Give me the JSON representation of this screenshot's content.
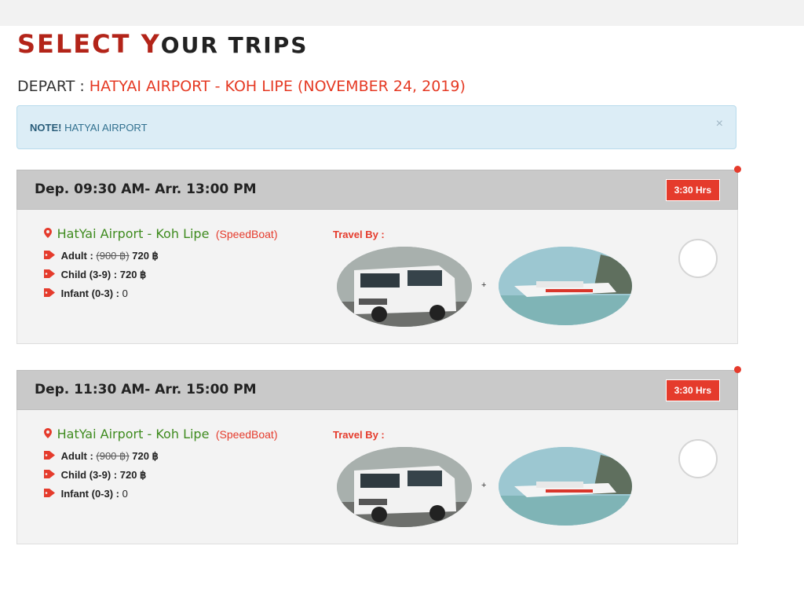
{
  "header": {
    "title_s": "S",
    "title_elect": "ELECT ",
    "title_y": "Y",
    "title_rest": "OUR TRIPS"
  },
  "depart": {
    "label": "DEPART : ",
    "route": "HATYAI AIRPORT - KOH LIPE (NOVEMBER 24, 2019)"
  },
  "note": {
    "bold": "NOTE!",
    "text": " HATYAI AIRPORT",
    "close": "×"
  },
  "trips": [
    {
      "time": "Dep.  09:30 AM- Arr. 13:00 PM",
      "duration": "3:30 Hrs",
      "route": "HatYai Airport - Koh Lipe",
      "vehicle": "(SpeedBoat)",
      "adult_label": "Adult : ",
      "adult_old": "(900 ฿)",
      "adult_price": " 720 ฿",
      "child": "Child (3-9) : 720 ฿",
      "infant_label": "Infant (0-3) : ",
      "infant_price": "0",
      "travel_by": "Travel By :",
      "plus": "+"
    },
    {
      "time": "Dep.  11:30 AM- Arr. 15:00 PM",
      "duration": "3:30 Hrs",
      "route": "HatYai Airport - Koh Lipe",
      "vehicle": "(SpeedBoat)",
      "adult_label": "Adult : ",
      "adult_old": "(900 ฿)",
      "adult_price": " 720 ฿",
      "child": "Child (3-9) : 720 ฿",
      "infant_label": "Infant (0-3) : ",
      "infant_price": "0",
      "travel_by": "Travel By :",
      "plus": "+"
    }
  ],
  "icons": {
    "pin": "map-marker-icon",
    "tag": "tag-icon",
    "close": "close-icon"
  },
  "colors": {
    "accent_red": "#e53b2c",
    "route_green": "#3e8b1e",
    "note_bg": "#dcedf6"
  }
}
